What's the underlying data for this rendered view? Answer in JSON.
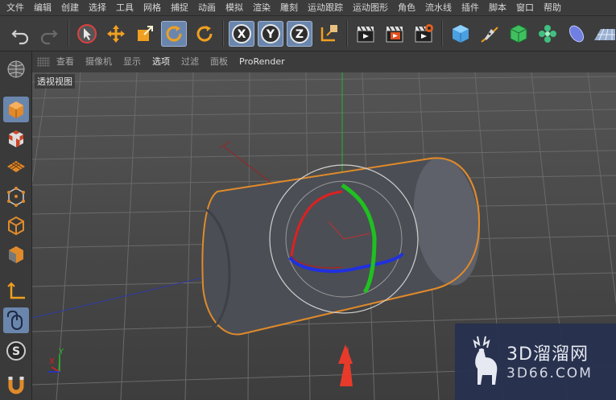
{
  "menubar": {
    "items": [
      "文件",
      "编辑",
      "创建",
      "选择",
      "工具",
      "网格",
      "捕捉",
      "动画",
      "模拟",
      "渲染",
      "雕刻",
      "运动跟踪",
      "运动图形",
      "角色",
      "流水线",
      "插件",
      "脚本",
      "窗口",
      "帮助"
    ]
  },
  "toolbar": {
    "axis_x": "X",
    "axis_y": "Y",
    "axis_z": "Z"
  },
  "viewport_menu": {
    "items": [
      "查看",
      "摄像机",
      "显示",
      "选项",
      "过滤",
      "面板",
      "ProRender"
    ],
    "active_index": 3
  },
  "viewport": {
    "label": "透视视图",
    "axis_x_label": "X",
    "axis_y_label": "Y"
  },
  "watermark": {
    "brand": "3D溜溜网",
    "site": "3D66.COM"
  },
  "colors": {
    "selection_blue": "#6a86ad",
    "object_outline": "#e08a2a",
    "axis_x": "#e02020",
    "axis_y": "#20c020",
    "axis_z": "#2030e0",
    "arrow_annotation": "#e83a2a"
  }
}
